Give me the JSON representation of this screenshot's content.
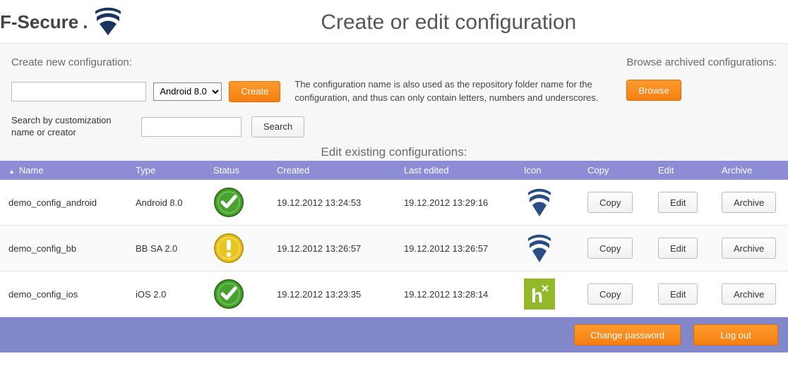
{
  "brand": {
    "name": "F-Secure"
  },
  "page_title": "Create or edit configuration",
  "create_section": {
    "label": "Create new configuration:",
    "platform_selected": "Android 8.0",
    "create_button": "Create",
    "hint": "The configuration name is also used as the repository folder name for the configuration, and thus can only contain letters, numbers and underscores."
  },
  "archived_section": {
    "label": "Browse archived configurations:",
    "browse_button": "Browse"
  },
  "search_section": {
    "label": "Search by customization name or creator",
    "search_button": "Search"
  },
  "table": {
    "title": "Edit existing configurations:",
    "headers": {
      "name": "Name",
      "type": "Type",
      "status": "Status",
      "created": "Created",
      "last_edited": "Last edited",
      "icon": "Icon",
      "copy": "Copy",
      "edit": "Edit",
      "archive": "Archive"
    },
    "rows": [
      {
        "name": "demo_config_android",
        "type": "Android 8.0",
        "status": "ok",
        "created": "19.12.2012 13:24:53",
        "last_edited": "19.12.2012 13:29:16",
        "icon": "fsecure"
      },
      {
        "name": "demo_config_bb",
        "type": "BB SA 2.0",
        "status": "warn",
        "created": "19.12.2012 13:26:57",
        "last_edited": "19.12.2012 13:26:57",
        "icon": "fsecure"
      },
      {
        "name": "demo_config_ios",
        "type": "iOS 2.0",
        "status": "ok",
        "created": "19.12.2012 13:23:35",
        "last_edited": "19.12.2012 13:28:14",
        "icon": "green-h"
      }
    ],
    "action_labels": {
      "copy": "Copy",
      "edit": "Edit",
      "archive": "Archive"
    }
  },
  "footer": {
    "change_password": "Change password",
    "log_out": "Log out"
  }
}
